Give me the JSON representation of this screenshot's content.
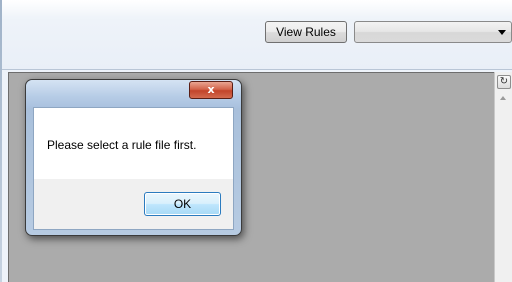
{
  "toolbar": {
    "view_rules_label": "View Rules",
    "rule_file_select_value": ""
  },
  "dialog": {
    "close_glyph": "x",
    "message": "Please select a rule file first.",
    "ok_label": "OK"
  },
  "side_panel": {
    "refresh_glyph": "↻"
  },
  "colors": {
    "content_background": "#ababab",
    "close_button": "#c2442a",
    "ok_button_border": "#2b7bbf"
  }
}
